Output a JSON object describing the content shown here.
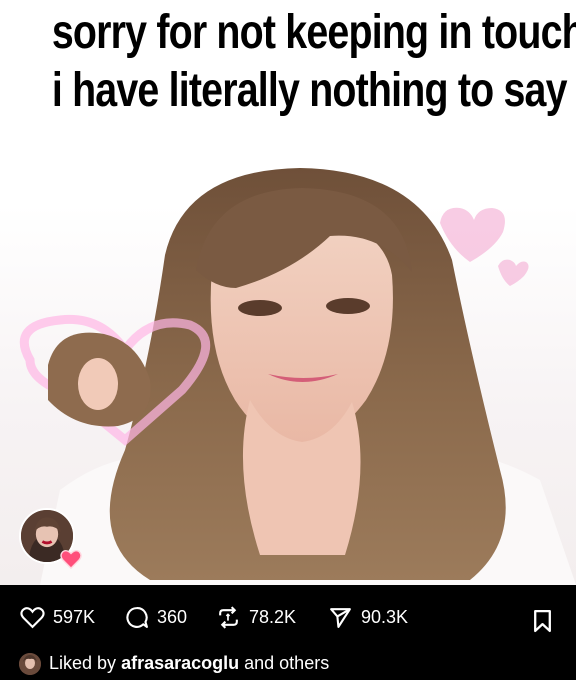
{
  "post": {
    "caption": [
      "sorry for not keeping in touch",
      "i have literally nothing to say"
    ]
  },
  "author": {
    "avatar_icon": "profile-photo",
    "badge_icon": "heart-icon"
  },
  "actions": {
    "likes": "597K",
    "comments": "360",
    "reposts": "78.2K",
    "shares": "90.3K"
  },
  "liked_by": {
    "prefix": "Liked by",
    "user": "afrasaracoglu",
    "suffix": "and others"
  },
  "colors": {
    "heart_pink": "#ff4f7b",
    "background": "#000000",
    "text": "#ffffff"
  }
}
